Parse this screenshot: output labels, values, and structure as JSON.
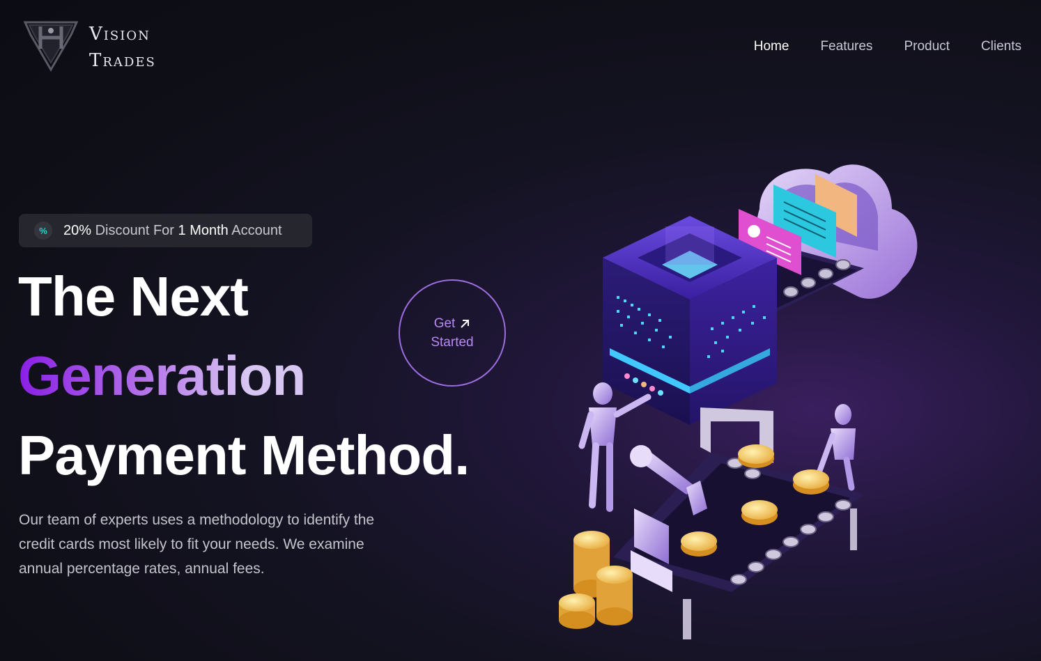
{
  "brand": {
    "line1": "Vision",
    "line2": "Trades"
  },
  "nav": {
    "items": [
      {
        "label": "Home"
      },
      {
        "label": "Features"
      },
      {
        "label": "Product"
      },
      {
        "label": "Clients"
      }
    ]
  },
  "badge": {
    "percent": "20%",
    "text1": "Discount For",
    "months": "1 Month",
    "text2": "Account"
  },
  "hero": {
    "line1": "The Next",
    "line2": "Generation",
    "line3": "Payment Method.",
    "description": "Our team of experts uses a methodology to identify the credit cards most likely to fit your needs. We examine annual percentage rates, annual fees."
  },
  "cta": {
    "line1": "Get",
    "line2": "Started"
  },
  "colors": {
    "accent": "#8a1ee6",
    "teal": "#21d4c8",
    "background": "#0f0f18"
  }
}
